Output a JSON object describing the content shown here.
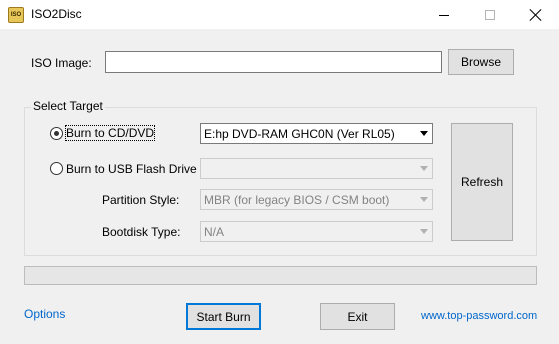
{
  "window": {
    "title": "ISO2Disc",
    "icon_text": "ISO"
  },
  "iso_image": {
    "label": "ISO Image:",
    "value": "",
    "browse_label": "Browse"
  },
  "select_target": {
    "caption": "Select Target",
    "burn_cd": {
      "label": "Burn to CD/DVD",
      "selected": true,
      "drive_value": "E:hp DVD-RAM GHC0N (Ver RL05)"
    },
    "burn_usb": {
      "label": "Burn to USB Flash Drive",
      "selected": false,
      "drive_value": ""
    },
    "partition_style": {
      "label": "Partition Style:",
      "value": "MBR (for legacy BIOS / CSM boot)"
    },
    "bootdisk_type": {
      "label": "Bootdisk Type:",
      "value": "N/A"
    },
    "refresh_label": "Refresh"
  },
  "progress": {
    "value": 0
  },
  "footer": {
    "options_label": "Options",
    "start_burn_label": "Start Burn",
    "exit_label": "Exit",
    "website_label": "www.top-password.com"
  },
  "colors": {
    "link": "#0066cc",
    "focus_border": "#0078d7",
    "progress_fill": "#06b025"
  },
  "icons": [
    "app-icon",
    "minimize-icon",
    "maximize-icon",
    "close-icon",
    "dropdown-arrow-icon"
  ]
}
